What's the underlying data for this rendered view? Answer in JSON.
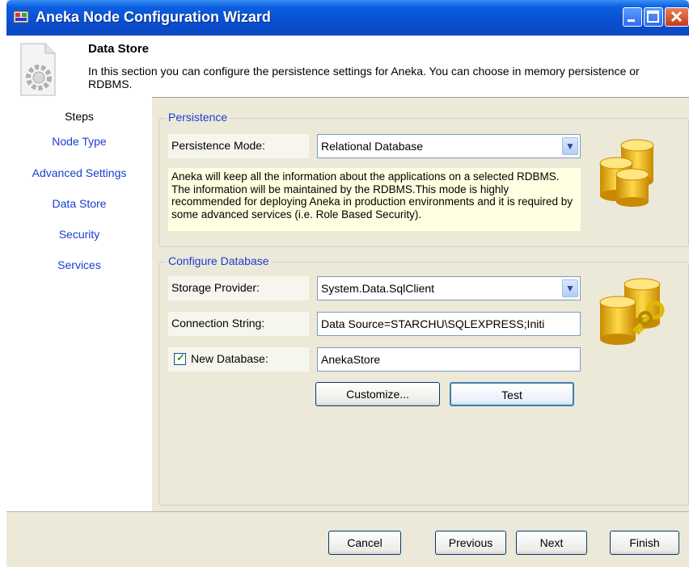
{
  "window": {
    "title": "Aneka Node Configuration Wizard"
  },
  "header": {
    "title": "Data Store",
    "description": "In this section you can configure the persistence settings for Aneka. You can choose in memory persistence or RDBMS."
  },
  "steps": {
    "title": "Steps",
    "items": [
      {
        "label": "Node Type"
      },
      {
        "label": "Advanced Settings"
      },
      {
        "label": "Data Store"
      },
      {
        "label": "Security"
      },
      {
        "label": "Services"
      }
    ]
  },
  "persistence": {
    "group_label": "Persistence",
    "mode_label": "Persistence Mode:",
    "mode_value": "Relational Database",
    "info": "Aneka will keep all the information about the applications on a selected RDBMS. The information will be maintained by the RDBMS.This mode is highly recommended for deploying Aneka in production environments and it is required by some advanced services (i.e. Role Based Security)."
  },
  "database": {
    "group_label": "Configure Database",
    "provider_label": "Storage Provider:",
    "provider_value": "System.Data.SqlClient",
    "connection_label": "Connection String:",
    "connection_value": "Data Source=STARCHU\\SQLEXPRESS;Initi",
    "new_db_label": "New Database:",
    "new_db_checked": true,
    "new_db_value": "AnekaStore",
    "customize_label": "Customize...",
    "test_label": "Test"
  },
  "footer": {
    "cancel_label": "Cancel",
    "previous_label": "Previous",
    "next_label": "Next",
    "finish_label": "Finish"
  },
  "colors": {
    "accent": "#1a3ed0",
    "titlebar": "#0a4fd0",
    "info_bg": "#ffffe1"
  },
  "icons": [
    "app-icon",
    "minimize-icon",
    "maximize-icon",
    "close-icon",
    "gear-icon",
    "database-icon",
    "database-key-icon",
    "dropdown-arrow-icon",
    "checkmark-icon"
  ]
}
